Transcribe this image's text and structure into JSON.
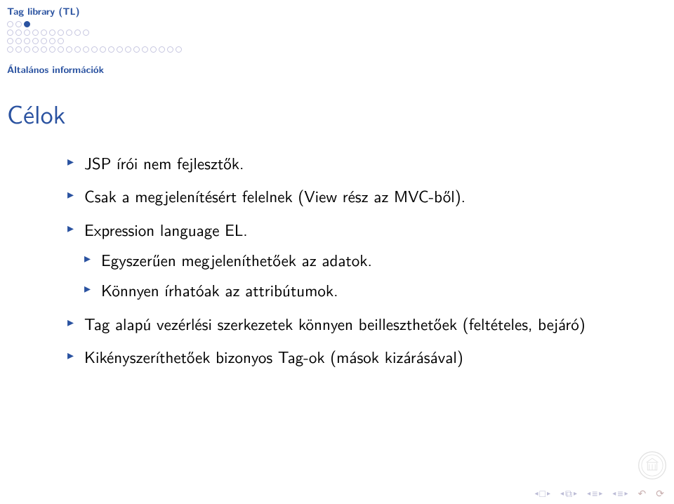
{
  "header": {
    "section_title": "Tag library (TL)",
    "subsection_title": "Általános információk",
    "progress": [
      [
        1,
        1,
        2
      ],
      [
        0,
        0,
        0,
        0,
        0,
        0,
        0,
        0,
        0,
        0
      ],
      [
        0,
        0,
        0,
        0,
        0,
        0,
        0
      ],
      [
        0,
        0,
        0,
        0,
        0,
        0,
        0,
        0,
        0,
        0,
        0,
        0,
        0,
        0,
        0,
        0,
        0,
        0,
        0,
        0,
        0
      ]
    ]
  },
  "slide": {
    "title": "Célok",
    "bullets": {
      "b1": "JSP írói nem fejlesztők.",
      "b2": "Csak a megjelenítésért felelnek (View rész az MVC-ből).",
      "b3": "Expression language EL.",
      "b3_sub": {
        "s1": "Egyszerűen megjeleníthetőek az adatok.",
        "s2": "Könnyen írhatóak az attribútumok."
      },
      "b4": "Tag alapú vezérlési szerkezetek könnyen beilleszthetőek (feltételes, bejáró)",
      "b5": "Kikényszeríthetőek bizonyos Tag-ok (mások kizárásával)"
    }
  },
  "nav": {
    "first": "□",
    "prev_section": "◻",
    "prev": "≡",
    "next": "≡",
    "cycle": "↻"
  }
}
